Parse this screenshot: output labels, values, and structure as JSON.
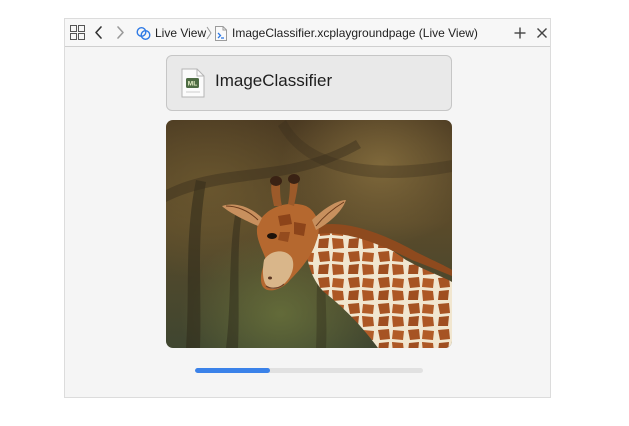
{
  "titlebar": {
    "breadcrumb": {
      "live_view_label": "Live View",
      "page_label": "ImageClassifier.xcplaygroundpage (Live View)"
    },
    "icons": {
      "grid": "grid-icon",
      "back": "chevron-left-icon",
      "forward": "chevron-right-icon",
      "live_view": "live-view-icon",
      "separator": "chevron-right-icon",
      "playground_page": "swift-file-icon",
      "add": "plus-icon",
      "close": "close-icon"
    }
  },
  "live_view": {
    "model": {
      "icon": "mlmodel-file-icon",
      "icon_badge": "ML",
      "title": "ImageClassifier"
    },
    "image": {
      "subject": "giraffe"
    },
    "progress": {
      "fraction": 0.33,
      "color": "#3b82e9"
    }
  },
  "colors": {
    "window_background": "#f5f5f5",
    "panel_background": "#e9e9e9",
    "accent": "#3b82e9"
  }
}
